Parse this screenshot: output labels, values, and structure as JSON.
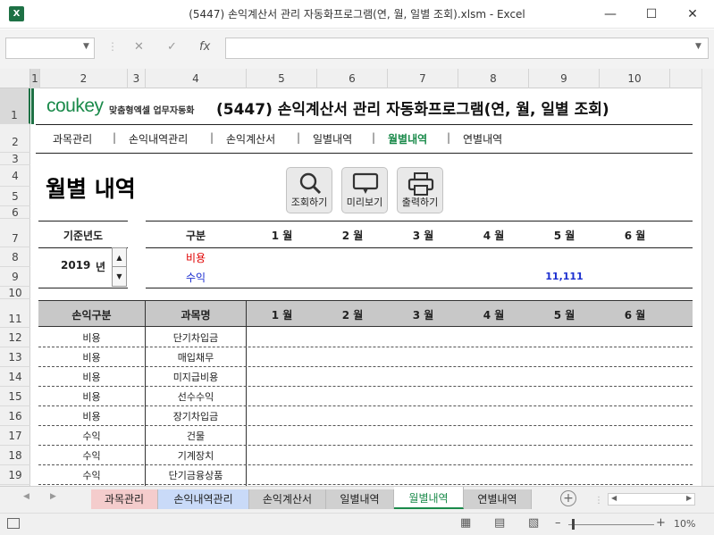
{
  "window": {
    "title": "(5447) 손익계산서 관리 자동화프로그램(연, 월, 일별 조회).xlsm - Excel",
    "app_icon": "X"
  },
  "formula_bar": {
    "fx": "fx",
    "cancel": "✕",
    "confirm": "✓"
  },
  "columns": [
    "1",
    "2",
    "3",
    "4",
    "5",
    "6",
    "7",
    "8",
    "9",
    "10"
  ],
  "rows": [
    "1",
    "2",
    "3",
    "4",
    "5",
    "6",
    "7",
    "8",
    "9",
    "10",
    "11",
    "12",
    "13",
    "14",
    "15",
    "16",
    "17",
    "18",
    "19"
  ],
  "banner": {
    "logo_main": "coukey",
    "logo_sub": "맞춤형엑셀 업무자동화",
    "title": "(5447) 손익계산서 관리 자동화프로그램(연, 월, 일별 조회)"
  },
  "nav": [
    "과목관리",
    "손익내역관리",
    "손익계산서",
    "일별내역",
    "월별내역",
    "연별내역"
  ],
  "nav_separator": "|",
  "page_title": "월별 내역",
  "buttons": {
    "search": "조회하기",
    "preview": "미리보기",
    "print": "출력하기"
  },
  "summary": {
    "base_year_label": "기준년도",
    "year_value": "2019",
    "year_suffix": "년",
    "category_header": "구분",
    "months": [
      "1 월",
      "2 월",
      "3 월",
      "4 월",
      "5 월",
      "6 월"
    ],
    "expense_label": "비용",
    "income_label": "수익",
    "income_values": [
      "",
      "",
      "",
      "",
      "11,111",
      ""
    ]
  },
  "detail": {
    "headers": [
      "손익구분",
      "과목명"
    ],
    "rows": [
      {
        "type": "비용",
        "account": "단기차입금"
      },
      {
        "type": "비용",
        "account": "매입채무"
      },
      {
        "type": "비용",
        "account": "미지급비용"
      },
      {
        "type": "비용",
        "account": "선수수익"
      },
      {
        "type": "비용",
        "account": "장기차입금"
      },
      {
        "type": "수익",
        "account": "건물"
      },
      {
        "type": "수익",
        "account": "기계장치"
      },
      {
        "type": "수익",
        "account": "단기금융상품"
      }
    ]
  },
  "sheet_tabs": [
    {
      "label": "과목관리",
      "color": "#f4cccc"
    },
    {
      "label": "손익내역관리",
      "color": "#c9daf8"
    },
    {
      "label": "손익계산서",
      "color": "#d0d0d0"
    },
    {
      "label": "일별내역",
      "color": "#d0d0d0"
    },
    {
      "label": "월별내역",
      "color": "#ffffff"
    },
    {
      "label": "연별내역",
      "color": "#d0d0d0"
    }
  ],
  "status": {
    "zoom": "10%"
  },
  "colors": {
    "accent": "#1a8a4a",
    "expense": "#e00000",
    "income": "#1c2fd0",
    "header_bg": "#c8c8c8"
  }
}
